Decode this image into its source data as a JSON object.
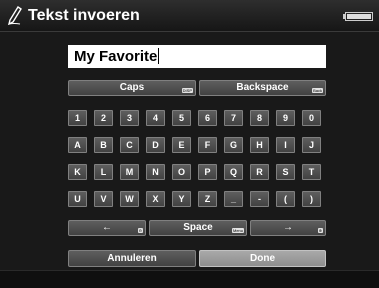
{
  "window": {
    "title": "Tekst invoeren",
    "icon": "pen-icon",
    "status_icon": "battery-icon"
  },
  "input": {
    "value": "My Favorite"
  },
  "top_keys": [
    {
      "label": "Caps",
      "shortcut": "DISP"
    },
    {
      "label": "Backspace",
      "shortcut": "Back"
    }
  ],
  "key_rows": [
    [
      "1",
      "2",
      "3",
      "4",
      "5",
      "6",
      "7",
      "8",
      "9",
      "0"
    ],
    [
      "A",
      "B",
      "C",
      "D",
      "E",
      "F",
      "G",
      "H",
      "I",
      "J"
    ],
    [
      "K",
      "L",
      "M",
      "N",
      "O",
      "P",
      "Q",
      "R",
      "S",
      "T"
    ],
    [
      "U",
      "V",
      "W",
      "X",
      "Y",
      "Z",
      "_",
      "-",
      "(",
      ")"
    ]
  ],
  "nav_keys": [
    {
      "label": "←",
      "shortcut": "⊖"
    },
    {
      "label": "Space",
      "shortcut": "Menu"
    },
    {
      "label": "→",
      "shortcut": "⊕"
    }
  ],
  "actions": {
    "cancel": "Annuleren",
    "done": "Done"
  },
  "colors": {
    "background": "#000000",
    "panel": "#191919",
    "key": "#4f4f4f",
    "key_border": "#808080",
    "done": "#9a9a9a"
  }
}
